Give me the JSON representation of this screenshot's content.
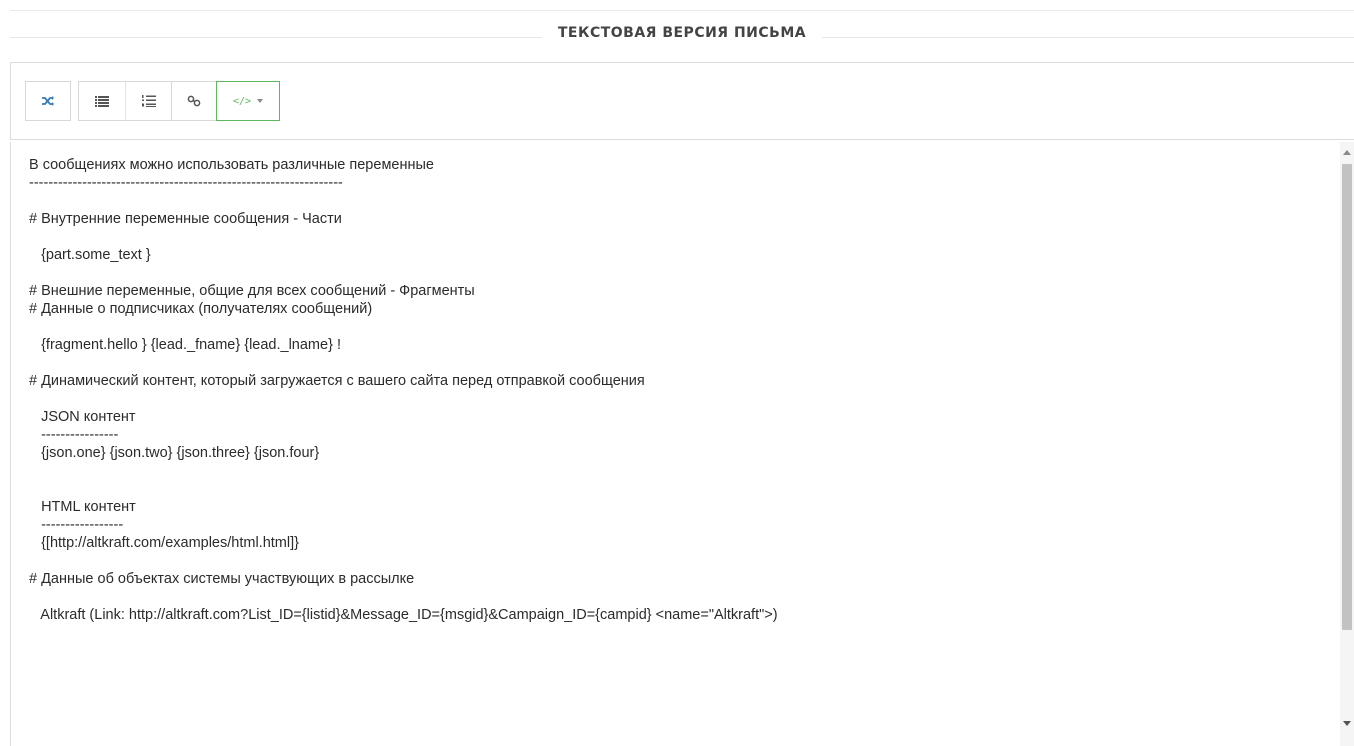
{
  "header": {
    "title": "ТЕКСТОВАЯ ВЕРСИЯ ПИСЬМА"
  },
  "toolbar": {
    "buttons": [
      {
        "name": "shuffle",
        "icon": "shuffle-icon"
      },
      {
        "name": "bulleted-list",
        "icon": "bulleted-list-icon"
      },
      {
        "name": "numbered-list",
        "icon": "numbered-list-icon"
      },
      {
        "name": "link",
        "icon": "link-icon"
      },
      {
        "name": "code",
        "icon": "code-icon",
        "label": "</>"
      }
    ],
    "accent_color": "#5cb85c",
    "shuffle_color": "#337ab7"
  },
  "editor": {
    "lines": [
      "В сообщениях можно использовать различные переменные",
      "-----------------------------------------------------------------",
      "",
      "# Внутренние переменные сообщения - Части",
      "",
      "   {part.some_text }",
      "",
      "# Внешние переменные, общие для всех сообщений - Фрагменты",
      "# Данные о подписчиках (получателях сообщений)",
      "",
      "   {fragment.hello } {lead._fname} {lead._lname} !",
      "",
      "# Динамический контент, который загружается с вашего сайта перед отправкой сообщения",
      "",
      "   JSON контент",
      "   ----------------",
      "   {json.one} {json.two} {json.three} {json.four}",
      "",
      "",
      "   HTML контент",
      "   -----------------",
      "   {[http://altkraft.com/examples/html.html]}",
      "",
      "# Данные об объектах системы участвующих в рассылке",
      "",
      "   Altkraft (Link: http://altkraft.com?List_ID={listid}&Message_ID={msgid}&Campaign_ID={campid} <name=\"Altkraft\">)"
    ]
  }
}
